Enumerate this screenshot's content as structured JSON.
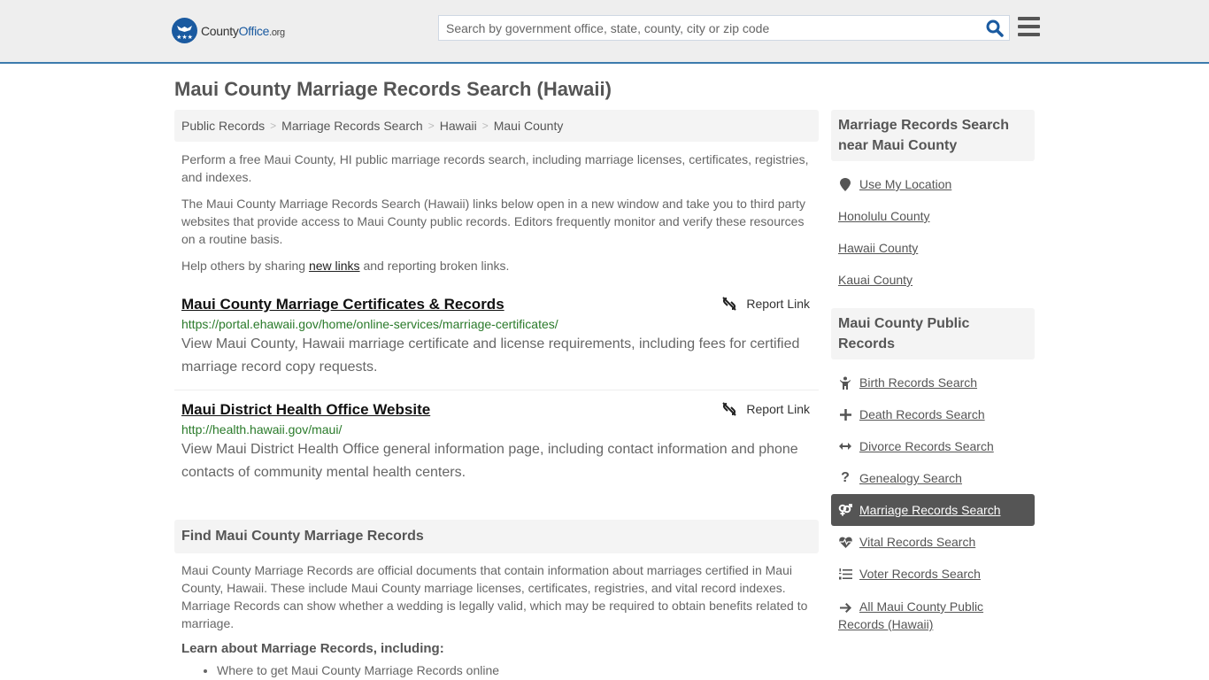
{
  "header": {
    "logo_text_main": "County",
    "logo_text_brand": "Office",
    "logo_text_tld": ".org",
    "search_placeholder": "Search by government office, state, county, city or zip code",
    "search_value": "",
    "search_icon": "search-icon",
    "menu_icon": "hamburger-menu-icon",
    "accent_color": "#3c7bad"
  },
  "page_title": "Maui County Marriage Records Search (Hawaii)",
  "breadcrumb": [
    "Public Records",
    "Marriage Records Search",
    "Hawaii",
    "Maui County"
  ],
  "intro": {
    "p1": "Perform a free Maui County, HI public marriage records search, including marriage licenses, certificates, registries, and indexes.",
    "p2": "The Maui County Marriage Records Search (Hawaii) links below open in a new window and take you to third party websites that provide access to Maui County public records. Editors frequently monitor and verify these resources on a routine basis.",
    "p3_before": "Help others by sharing ",
    "p3_link": "new links",
    "p3_after": " and reporting broken links."
  },
  "results": [
    {
      "title": "Maui County Marriage Certificates & Records",
      "url": "https://portal.ehawaii.gov/home/online-services/marriage-certificates/",
      "description": "View Maui County, Hawaii marriage certificate and license requirements, including fees for certified marriage record copy requests.",
      "report_label": "Report Link"
    },
    {
      "title": "Maui District Health Office Website",
      "url": "http://health.hawaii.gov/maui/",
      "description": "View Maui District Health Office general information page, including contact information and phone contacts of community mental health centers.",
      "report_label": "Report Link"
    }
  ],
  "find_section": {
    "heading": "Find Maui County Marriage Records",
    "body": "Maui County Marriage Records are official documents that contain information about marriages certified in Maui County, Hawaii. These include Maui County marriage licenses, certificates, registries, and vital record indexes. Marriage Records can show whether a wedding is legally valid, which may be required to obtain benefits related to marriage.",
    "learn_heading": "Learn about Marriage Records, including:",
    "learn_items": [
      "Where to get Maui County Marriage Records online"
    ]
  },
  "sidebar": {
    "near_heading": "Marriage Records Search near Maui County",
    "near_items": [
      {
        "label": "Use My Location",
        "icon": "map-marker-icon"
      },
      {
        "label": "Honolulu County"
      },
      {
        "label": "Hawaii County"
      },
      {
        "label": "Kauai County"
      }
    ],
    "records_heading": "Maui County Public Records",
    "records_items": [
      {
        "label": "Birth Records Search",
        "icon": "child-icon"
      },
      {
        "label": "Death Records Search",
        "icon": "plus-icon"
      },
      {
        "label": "Divorce Records Search",
        "icon": "arrows-horizontal-icon"
      },
      {
        "label": "Genealogy Search",
        "icon": "question-icon"
      },
      {
        "label": "Marriage Records Search",
        "icon": "venus-mars-icon",
        "active": true
      },
      {
        "label": "Vital Records Search",
        "icon": "heartbeat-icon"
      },
      {
        "label": "Voter Records Search",
        "icon": "list-ol-icon"
      },
      {
        "label": "All Maui County Public Records (Hawaii)",
        "icon": "arrow-right-icon"
      }
    ]
  }
}
